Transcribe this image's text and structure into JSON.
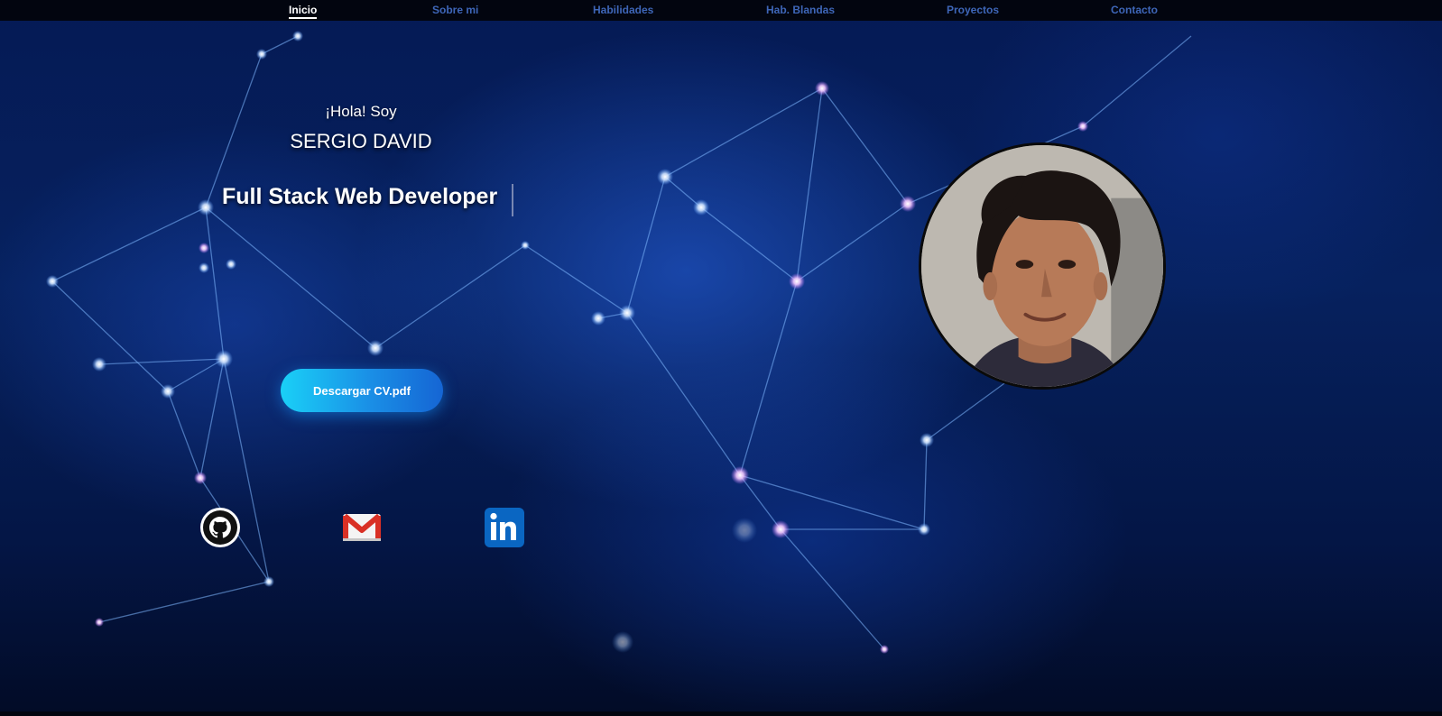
{
  "nav": {
    "items": [
      {
        "label": "Inicio",
        "active": true
      },
      {
        "label": "Sobre mi",
        "active": false
      },
      {
        "label": "Habilidades",
        "active": false
      },
      {
        "label": "Hab. Blandas",
        "active": false
      },
      {
        "label": "Proyectos",
        "active": false
      },
      {
        "label": "Contacto",
        "active": false
      }
    ],
    "active_color": "#ffffff",
    "inactive_color": "#3e66b8"
  },
  "hero": {
    "greeting": "¡Hola! Soy",
    "name": "SERGIO DAVID",
    "role": "Full Stack Web Developer",
    "cv_button": "Descargar CV.pdf"
  },
  "social": {
    "github": {
      "icon": "github-icon"
    },
    "gmail": {
      "icon": "gmail-icon"
    },
    "linkedin": {
      "icon": "linkedin-icon"
    }
  },
  "avatar": {
    "icon": "profile-photo"
  },
  "colors": {
    "background": "#051a55",
    "button_start": "#1ad0f7",
    "button_end": "#1565d4",
    "linkedin": "#0a66c2",
    "gmail_red": "#d93025"
  }
}
